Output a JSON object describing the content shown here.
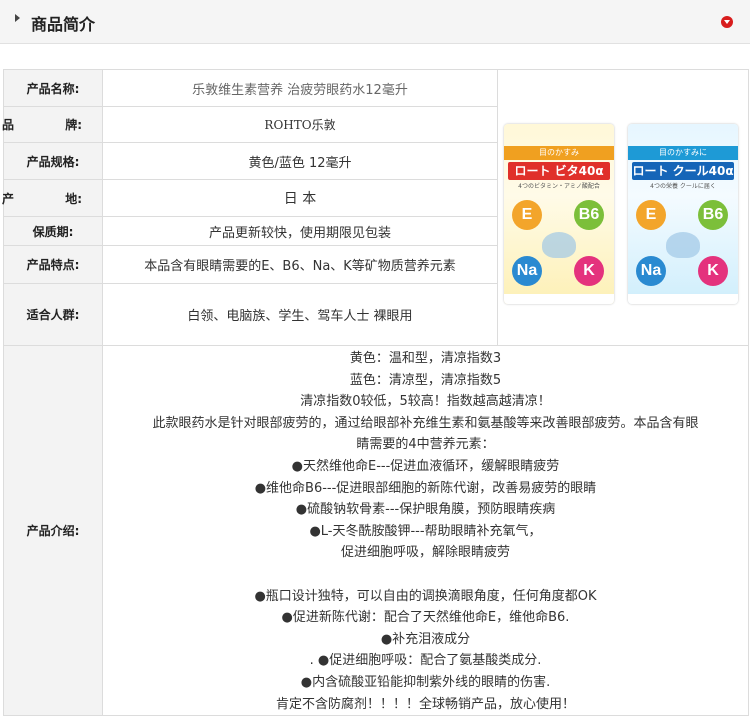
{
  "header": {
    "title": "商品简介",
    "collapse_icon": "collapse-circle-icon",
    "accent_color": "#d81d1d"
  },
  "spec": {
    "name_label": "产品名称:",
    "name_value": "乐敦维生素营养 治疲劳眼药水12毫升",
    "brand_label_left": "品",
    "brand_label_right": "牌:",
    "brand_value": "ROHTO乐敦",
    "size_label": "产品规格:",
    "size_value": "黄色/蓝色 12毫升",
    "origin_label_left": "产",
    "origin_label_right": "地:",
    "origin_value": "日 本",
    "shelf_label": "保质期:",
    "shelf_value": "产品更新较快，使用期限见包装",
    "feature_label": "产品特点:",
    "feature_value": "本品含有眼睛需要的E、B6、Na、K等矿物质营养元素",
    "crowd_label": "适合人群:",
    "crowd_value": "白领、电脑族、学生、驾车人士 裸眼用",
    "intro_label": "产品介绍:"
  },
  "product_image": {
    "left_box": {
      "band": "目のかすみ",
      "brand": "ロート ビタ40α",
      "sub": "4つのビタミン・アミノ酸配合",
      "circles": [
        "E",
        "B6",
        "Na",
        "K"
      ]
    },
    "right_box": {
      "band": "目のかすみに",
      "brand": "ロート クール40α",
      "sub": "4つの栄養 クールに届く",
      "circles": [
        "E",
        "B6",
        "Na",
        "K"
      ]
    }
  },
  "intro_lines": [
    "黄色：温和型，清凉指数3",
    "蓝色：清凉型，清凉指数5",
    "清凉指数0较低，5较高！指数越高越清凉！",
    "此款眼药水是针对眼部疲劳的，通过给眼部补充维生素和氨基酸等来改善眼部疲劳。本品含有眼",
    "睛需要的4中营养元素：",
    "●天然维他命E---促进血液循环，缓解眼睛疲劳",
    "●维他命B6---促进眼部细胞的新陈代谢，改善易疲劳的眼睛",
    "●硫酸钠软骨素---保护眼角膜，预防眼睛疾病",
    "●L-天冬酰胺酸钾---帮助眼睛补充氧气，",
    "促进细胞呼吸，解除眼睛疲劳",
    "",
    "●瓶口设计独特，可以自由的调换滴眼角度，任何角度都OK",
    "●促进新陈代谢：配合了天然维他命E，维他命B6.",
    "●补充泪液成分",
    ". ●促进细胞呼吸：配合了氨基酸类成分.",
    "●内含硫酸亚铅能抑制紫外线的眼睛的伤害.",
    "肯定不含防腐剂！！！！全球畅销产品，放心使用！"
  ]
}
